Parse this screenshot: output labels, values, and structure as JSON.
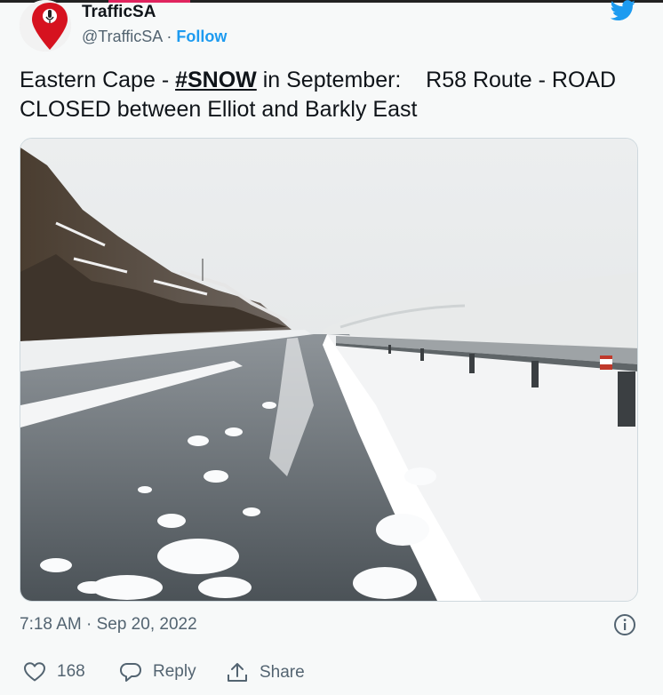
{
  "author": {
    "name": "TrafficSA",
    "handle": "@TrafficSA",
    "separator": "·",
    "follow_label": "Follow"
  },
  "tweet": {
    "text_before": "Eastern Cape - ",
    "hashtag": "#SNOW",
    "text_after": " in September:    R58 Route - ROAD CLOSED between Elliot and Barkly East",
    "timestamp": "7:18 AM · Sep 20, 2022"
  },
  "actions": {
    "like_count": "168",
    "reply_label": "Reply",
    "share_label": "Share"
  },
  "colors": {
    "accent": "#1d9bf0",
    "text": "#0f1419",
    "muted": "#536471",
    "avatar_pin": "#d6121f"
  },
  "icons": [
    "map-pin-icon",
    "twitter-bird-icon",
    "info-icon",
    "heart-icon",
    "reply-icon",
    "share-icon"
  ]
}
